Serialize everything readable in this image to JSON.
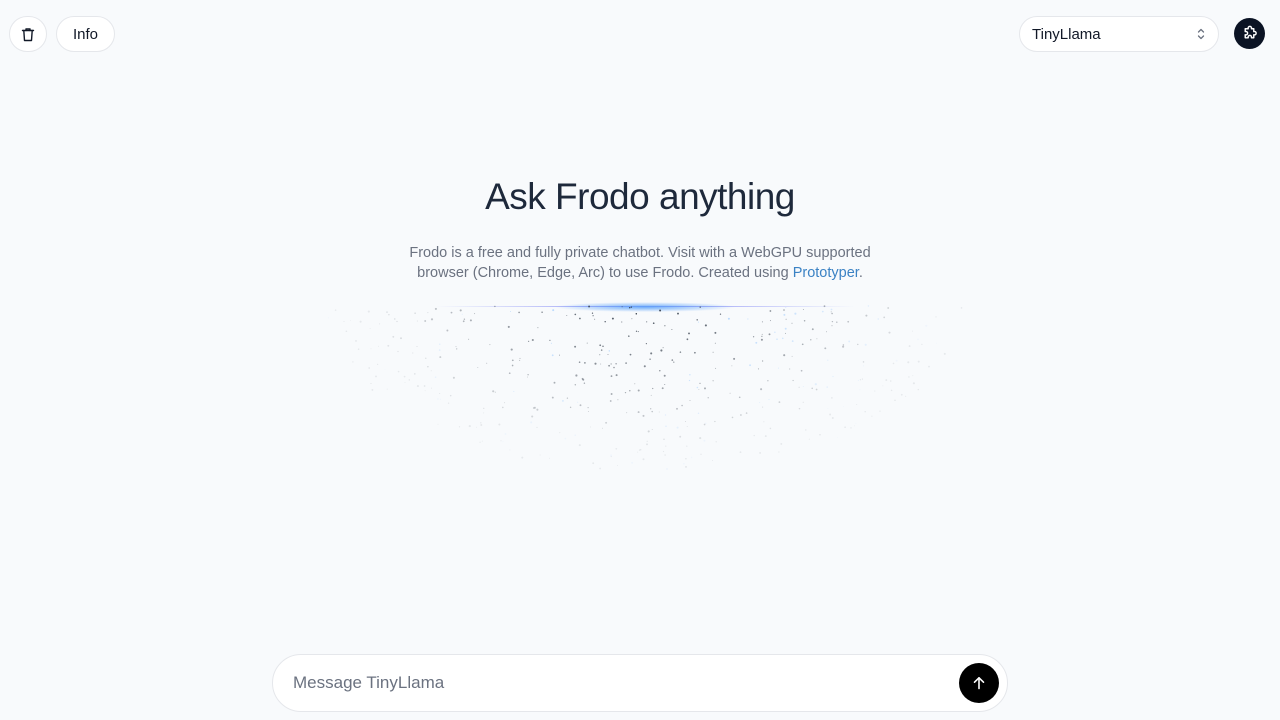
{
  "header": {
    "delete_icon": "trash-icon",
    "info_label": "Info",
    "model_select": {
      "value": "TinyLlama",
      "icon": "chevron-up-down-icon"
    },
    "avatar_icon": "puzzle-icon"
  },
  "hero": {
    "title": "Ask Frodo anything",
    "subtitle_line1": "Frodo is a free and fully private chatbot. Visit with a WebGPU supported",
    "subtitle_line2": "browser (Chrome, Edge, Arc) to use Frodo. Created using ",
    "link_text": "Prototyper",
    "link_suffix": "."
  },
  "composer": {
    "placeholder": "Message TinyLlama",
    "value": "",
    "send_icon": "arrow-up-icon"
  },
  "colors": {
    "background": "#f8fafc",
    "link": "#3b82c4",
    "send_button": "#000000",
    "glow": "#60a5fa"
  }
}
